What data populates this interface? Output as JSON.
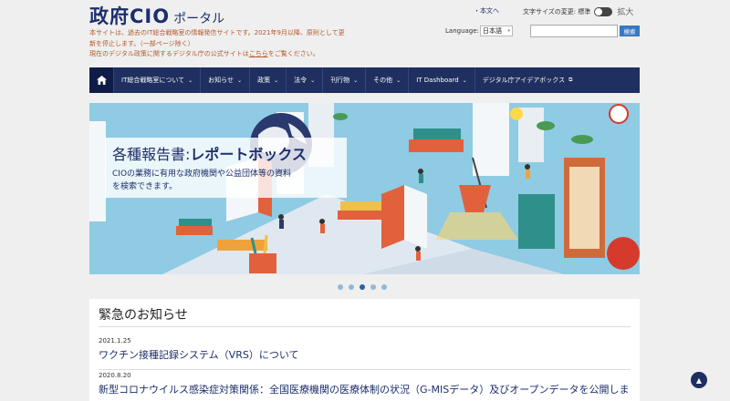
{
  "header": {
    "logo_main": "政府CIO",
    "logo_sub": "ポータル",
    "notice_lines": [
      "本サイトは、過去のIT総合戦略室の情報発信サイトです。2021年9月以降、原則として更",
      "新を停止します。（一部ページ除く）",
      "現在のデジタル政策に関するデジタル庁の公式サイトは",
      "こちら",
      "をご覧ください。"
    ],
    "english_link": "・本文へ",
    "font_size_label": "文字サイズの変更: 標準",
    "font_size_large": "拡大",
    "language_label": "Language:",
    "language_value": "日本語",
    "search_placeholder": "",
    "search_button": "検索"
  },
  "nav": {
    "items": [
      {
        "label": "IT総合戦略室について",
        "dropdown": true
      },
      {
        "label": "お知らせ",
        "dropdown": true
      },
      {
        "label": "政策",
        "dropdown": true
      },
      {
        "label": "法令",
        "dropdown": true
      },
      {
        "label": "刊行物",
        "dropdown": true
      },
      {
        "label": "その他",
        "dropdown": true
      },
      {
        "label": "IT Dashboard",
        "dropdown": true
      },
      {
        "label": "デジタル庁アイデアボックス",
        "dropdown": false
      }
    ]
  },
  "hero": {
    "title_prefix": "各種報告書:",
    "title_bold": "レポートボックス",
    "text_line1": "CIOの業務に有用な政府機関や公益団体等の資料",
    "text_line2": "を検索できます。",
    "active_slide": 3,
    "slide_count": 5
  },
  "emergency": {
    "title": "緊急のお知らせ",
    "items": [
      {
        "date": "2021.1.25",
        "text": "ワクチン接種記録システム（VRS）について"
      },
      {
        "date": "2020.8.20",
        "text": "新型コロナウイルス感染症対策関係：全国医療機関の医療体制の状況（G-MISデータ）及びオープンデータを公開しま"
      }
    ]
  },
  "colors": {
    "navy": "#1e2f60",
    "notice": "#b8572a",
    "hero_sky": "#8fcbe3",
    "accent_blue": "#3a78c2"
  }
}
